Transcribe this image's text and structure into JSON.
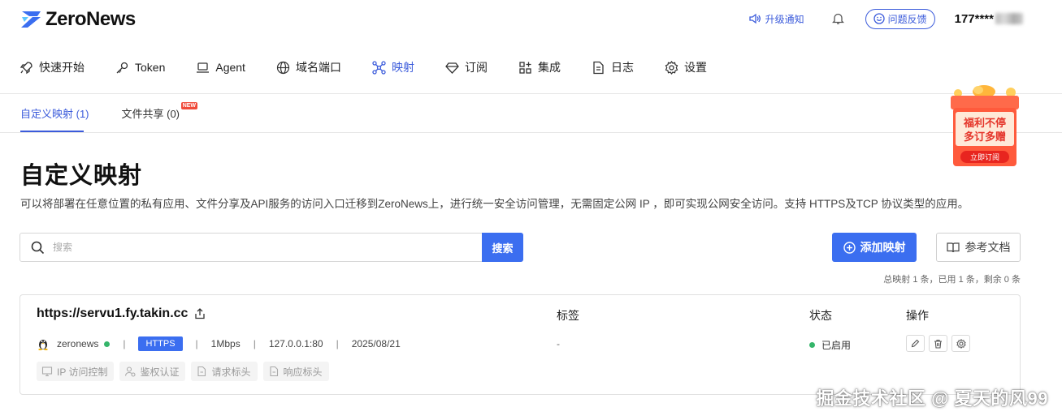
{
  "app": {
    "brand": "ZeroNews",
    "accent": "#3b6ef0"
  },
  "header": {
    "upgrade": "升级通知",
    "feedback": "问题反馈",
    "user_prefix": "177****"
  },
  "nav": [
    {
      "label": "快速开始",
      "icon": "rocket-icon"
    },
    {
      "label": "Token",
      "icon": "key-icon"
    },
    {
      "label": "Agent",
      "icon": "laptop-icon"
    },
    {
      "label": "域名端口",
      "icon": "globe-icon"
    },
    {
      "label": "映射",
      "icon": "network-icon",
      "active": true
    },
    {
      "label": "订阅",
      "icon": "diamond-icon"
    },
    {
      "label": "集成",
      "icon": "grid-plus-icon"
    },
    {
      "label": "日志",
      "icon": "document-icon"
    },
    {
      "label": "设置",
      "icon": "gear-icon"
    }
  ],
  "subtabs": {
    "custom": "自定义映射 (1)",
    "share": "文件共享 (0)",
    "new_badge": "NEW"
  },
  "page": {
    "title": "自定义映射",
    "description": "可以将部署在任意位置的私有应用、文件分享及API服务的访问入口迁移到ZeroNews上，进行统一安全访问管理，无需固定公网 IP ，即可实现公网安全访问。支持 HTTPS及TCP 协议类型的应用。"
  },
  "search": {
    "placeholder": "搜索",
    "button": "搜索"
  },
  "actions": {
    "add": "添加映射",
    "docs": "参考文档"
  },
  "summary": "总映射 1 条，已用 1 条，剩余 0 条",
  "columns": {
    "tags": "标签",
    "status": "状态",
    "ops": "操作"
  },
  "mapping": {
    "url": "https://servu1.fy.takin.cc",
    "agent": "zeronews",
    "protocol": "HTTPS",
    "bandwidth": "1Mbps",
    "address": "127.0.0.1:80",
    "date": "2025/08/21",
    "tags": "-",
    "status": "已启用",
    "chips": [
      "IP 访问控制",
      "鉴权认证",
      "请求标头",
      "响应标头"
    ]
  },
  "promo": {
    "line1": "福利不停",
    "line2": "多订多赠",
    "button": "立即订阅"
  },
  "watermark": "掘金技术社区 @ 夏天的风99"
}
